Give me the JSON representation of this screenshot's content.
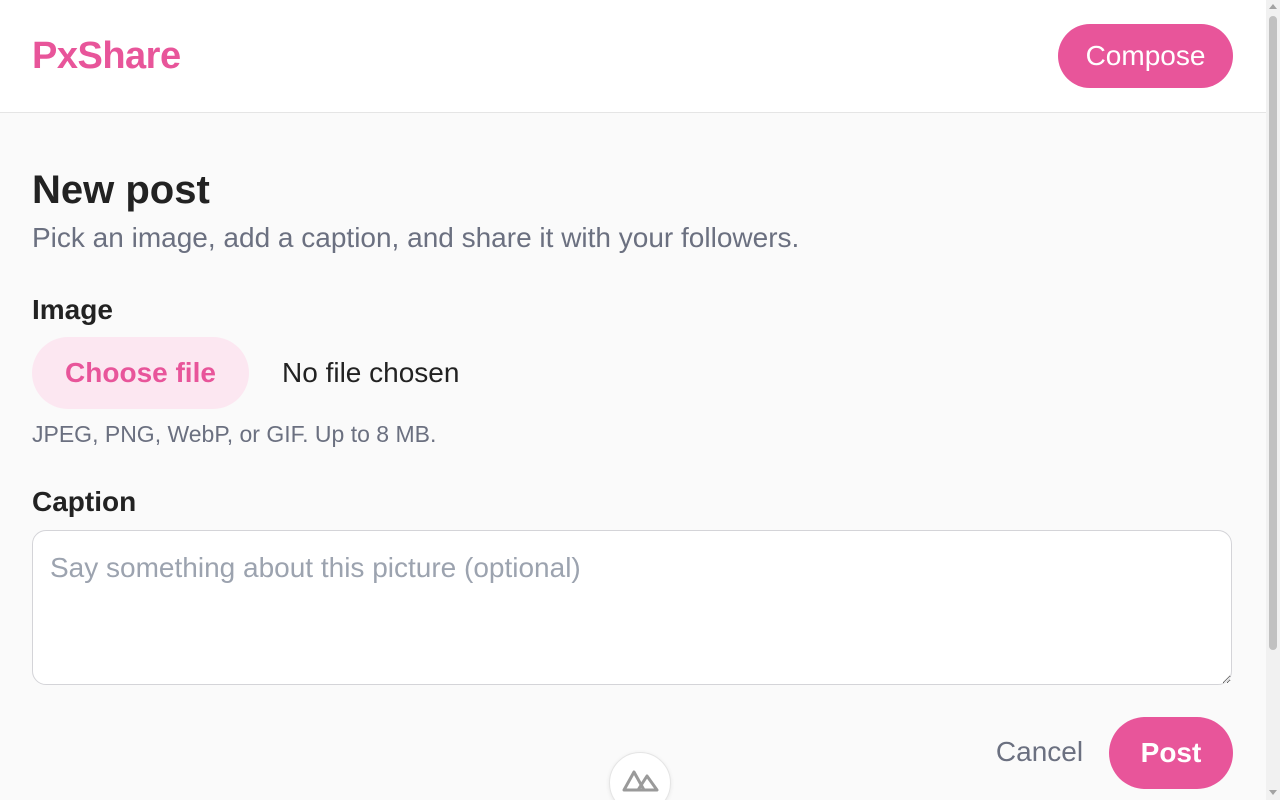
{
  "header": {
    "logo": "PxShare",
    "compose_label": "Compose"
  },
  "main": {
    "title": "New post",
    "subtitle": "Pick an image, add a caption, and share it with your followers.",
    "image_label": "Image",
    "choose_file_label": "Choose file",
    "file_status": "No file chosen",
    "hint": "JPEG, PNG, WebP, or GIF. Up to 8 MB.",
    "caption_label": "Caption",
    "caption_placeholder": "Say something about this picture (optional)",
    "caption_value": "",
    "cancel_label": "Cancel",
    "post_label": "Post"
  },
  "icons": {
    "dev_badge": "mountain-logo-icon"
  },
  "colors": {
    "accent": "#e8559a",
    "accent_soft": "#fce7f1",
    "muted_text": "#6b7080"
  }
}
